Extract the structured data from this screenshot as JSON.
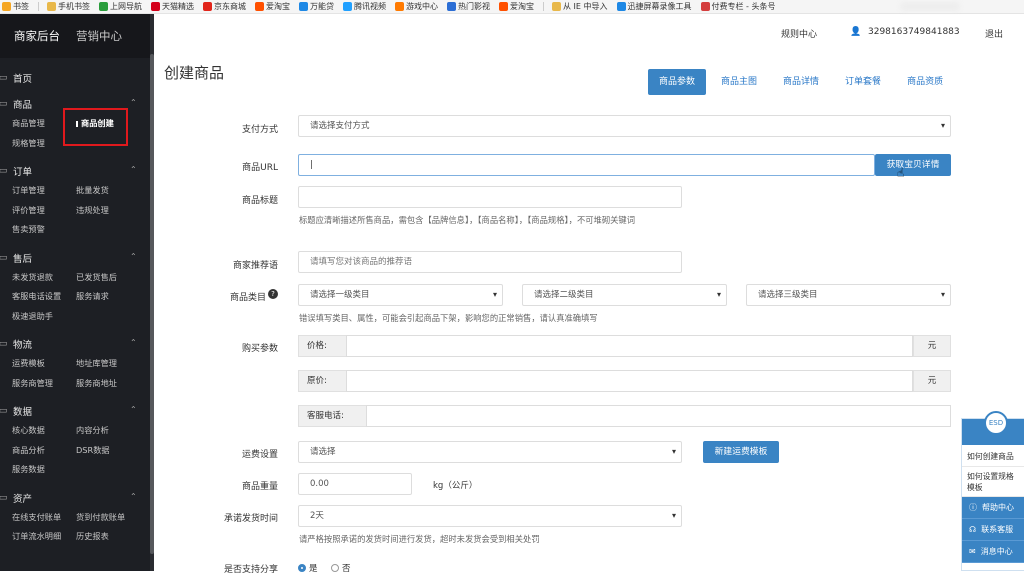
{
  "bookmarks": [
    {
      "label": "书签",
      "icon": "star-icon",
      "color": "#f5a623"
    },
    {
      "label": "手机书签",
      "icon": "folder-icon",
      "color": "#e8b84a"
    },
    {
      "label": "上网导航",
      "icon": "nav-icon",
      "color": "#2a9d3c"
    },
    {
      "label": "天猫精选",
      "icon": "tmall-icon",
      "color": "#d4001a"
    },
    {
      "label": "京东商城",
      "icon": "jd-icon",
      "color": "#e1251b"
    },
    {
      "label": "爱淘宝",
      "icon": "taobao-icon",
      "color": "#ff5000"
    },
    {
      "label": "万能贷",
      "icon": "loan-icon",
      "color": "#1e88e5"
    },
    {
      "label": "腾讯视频",
      "icon": "video-icon",
      "color": "#20a0ff"
    },
    {
      "label": "游戏中心",
      "icon": "game-icon",
      "color": "#ff7a00"
    },
    {
      "label": "热门影视",
      "icon": "film-icon",
      "color": "#2c6ed5"
    },
    {
      "label": "爱淘宝",
      "icon": "taobao-icon",
      "color": "#ff5000"
    },
    {
      "label": "从 IE 中导入",
      "icon": "folder-icon",
      "color": "#e8b84a"
    },
    {
      "label": "迅捷屏幕录像工具",
      "icon": "record-icon",
      "color": "#1e88e5"
    },
    {
      "label": "付费专栏 - 头条号",
      "icon": "toutiao-icon",
      "color": "#d43d3d"
    }
  ],
  "sidebar": {
    "brand": "商家后台",
    "marketing": "营销中心",
    "home": "首页",
    "groups": [
      {
        "title": "商品",
        "items": [
          "商品管理",
          "商品创建",
          "规格管理"
        ]
      },
      {
        "title": "订单",
        "items": [
          "订单管理",
          "批量发货",
          "评价管理",
          "违规处理",
          "售卖预警"
        ]
      },
      {
        "title": "售后",
        "items": [
          "未发货退款",
          "已发货售后",
          "客服电话设置",
          "服务请求",
          "极速退助手"
        ]
      },
      {
        "title": "物流",
        "items": [
          "运费模板",
          "地址库管理",
          "服务商管理",
          "服务商地址"
        ]
      },
      {
        "title": "数据",
        "items": [
          "核心数据",
          "内容分析",
          "商品分析",
          "DSR数据",
          "服务数据"
        ]
      },
      {
        "title": "资产",
        "items": [
          "在线支付账单",
          "货到付款账单",
          "订单流水明细",
          "历史报表"
        ]
      }
    ]
  },
  "header": {
    "rules": "规则中心",
    "account": "3298163749841883",
    "logout": "退出"
  },
  "page_title": "创建商品",
  "tabs": [
    "商品参数",
    "商品主图",
    "商品详情",
    "订单套餐",
    "商品资质"
  ],
  "form": {
    "pay_label": "支付方式",
    "pay_value": "请选择支付方式",
    "url_label": "商品URL",
    "url_button": "获取宝贝详情",
    "title_label": "商品标题",
    "title_hint": "标题应清晰描述所售商品，需包含【品牌信息】，【商品名称】，【商品规格】，不可堆砌关键词",
    "rec_label": "商家推荐语",
    "rec_placeholder": "请填写您对该商品的推荐语",
    "cat_label": "商品类目",
    "cat1": "请选择一级类目",
    "cat2": "请选择二级类目",
    "cat3": "请选择三级类目",
    "cat_hint": "错误填写类目、属性，可能会引起商品下架，影响您的正常销售，请认真准确填写",
    "buy_label": "购买参数",
    "price_label": "价格:",
    "orig_label": "原价:",
    "unit": "元",
    "phone_label": "客服电话:",
    "ship_label": "运费设置",
    "ship_value": "请选择",
    "ship_button": "新建运费模板",
    "weight_label": "商品重量",
    "weight_value": "0.00",
    "weight_unit": "kg（公斤）",
    "time_label": "承诺发货时间",
    "time_value": "2天",
    "time_hint": "请严格按照承诺的发货时间进行发货，超时未发货会受到相关处罚",
    "share_label": "是否支持分享",
    "share_yes": "是",
    "share_no": "否"
  },
  "help": {
    "avatar": "ESD",
    "questions": [
      "如何创建商品",
      "如何设置规格模板"
    ],
    "links": [
      "帮助中心",
      "联系客服",
      "消息中心"
    ]
  }
}
